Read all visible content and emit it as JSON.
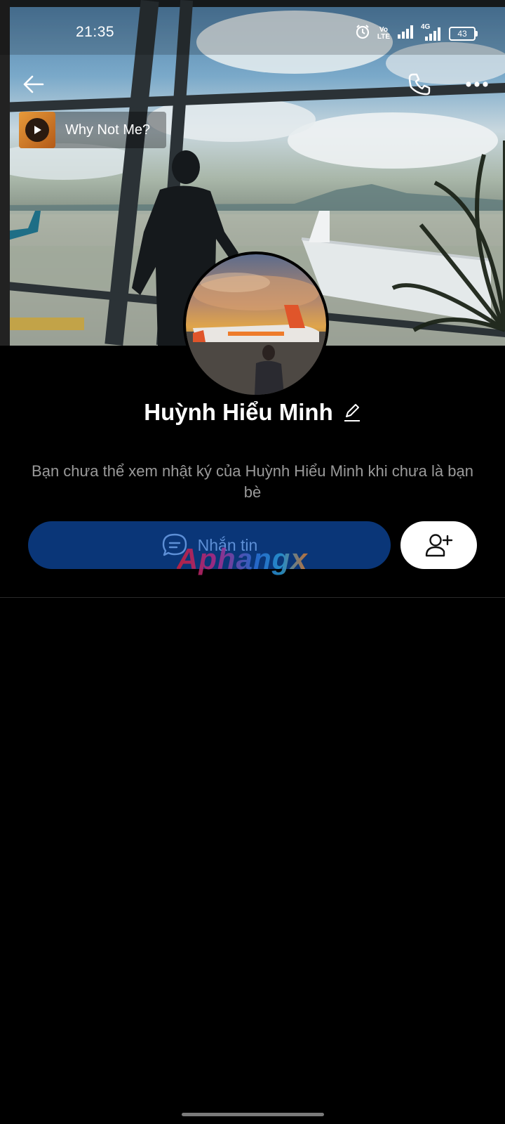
{
  "status_bar": {
    "time": "21:35",
    "network_label_1": "Vo",
    "network_label_2": "LTE",
    "network_type": "4G",
    "battery": "43",
    "icons": [
      "alarm-icon",
      "volte-icon",
      "signal-icon",
      "signal-4g-icon",
      "battery-icon"
    ]
  },
  "nav": {
    "icons": [
      "back-arrow-icon",
      "phone-icon",
      "more-dots-icon"
    ]
  },
  "music": {
    "title": "Why Not Me?"
  },
  "profile": {
    "name": "Huỳnh Hiểu Minh",
    "privacy_message": "Bạn chưa thể xem nhật ký của Huỳnh Hiểu Minh khi chưa là bạn bè"
  },
  "actions": {
    "message_label": "Nhắn tin"
  },
  "watermark": {
    "text": "Aphangx"
  },
  "colors": {
    "background": "#000000",
    "message_button": "#0a3678",
    "message_text": "#5d8fd6",
    "secondary_text": "#9a9a9a"
  }
}
